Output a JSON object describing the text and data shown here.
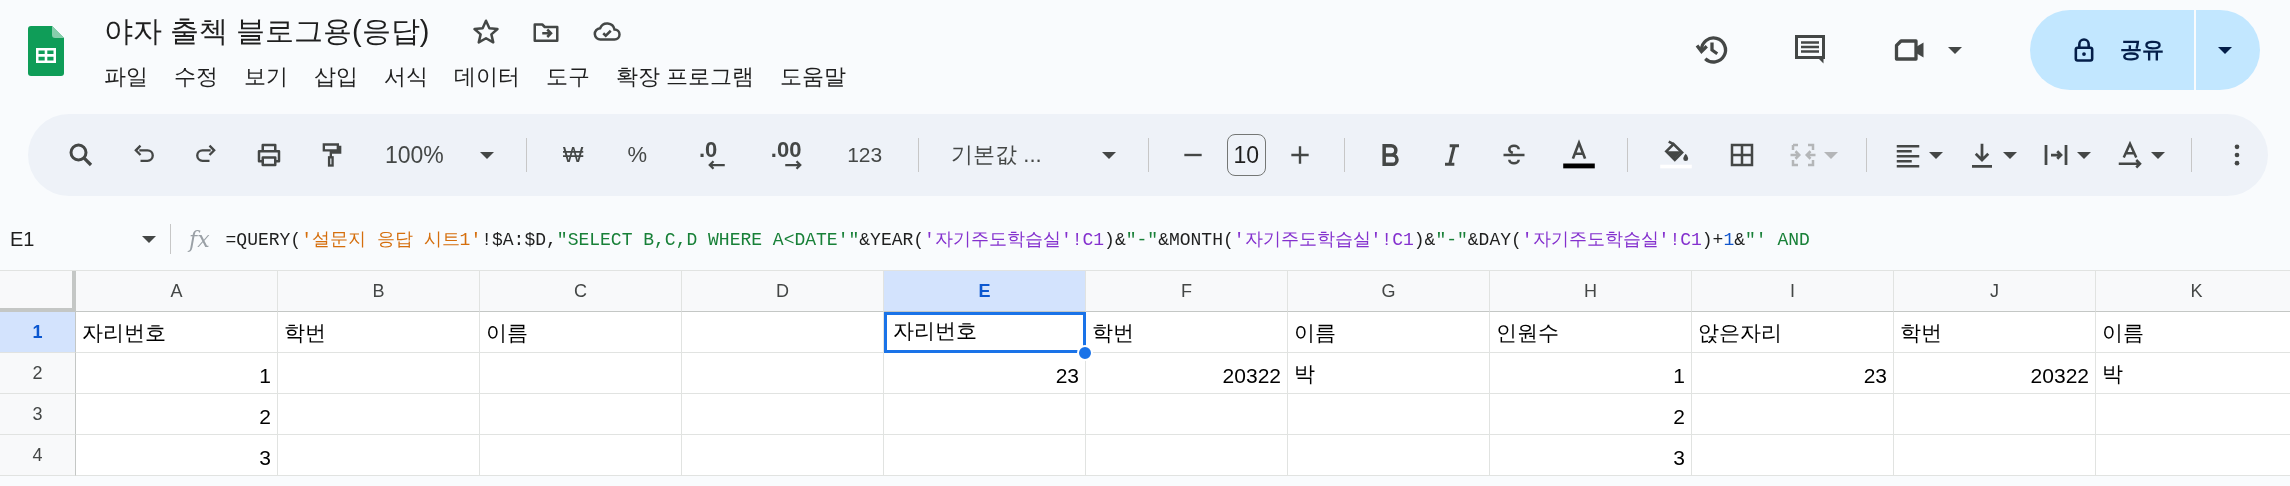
{
  "document": {
    "title": "야자 출첵 블로그용(응답)"
  },
  "menu": [
    "파일",
    "수정",
    "보기",
    "삽입",
    "서식",
    "데이터",
    "도구",
    "확장 프로그램",
    "도움말"
  ],
  "share_button": {
    "label": "공유"
  },
  "toolbar": {
    "zoom": "100%",
    "currency": "₩",
    "percent": "%",
    "decrease_decimal": ".0",
    "increase_decimal": ".00",
    "number_format": "123",
    "font": "기본값 ...",
    "font_size": "10",
    "merge_disabled": true
  },
  "formula_bar": {
    "cell": "E1",
    "fx": "fx",
    "segments": [
      {
        "text": "=QUERY(",
        "kind": "plain"
      },
      {
        "text": "'설문지 응답 시트1'",
        "kind": "range"
      },
      {
        "text": "!$A:$D,",
        "kind": "plain"
      },
      {
        "text": "\"SELECT B,C,D WHERE A<DATE'\"",
        "kind": "string"
      },
      {
        "text": "&YEAR(",
        "kind": "plain"
      },
      {
        "text": "'자기주도학습실'!C1",
        "kind": "ref"
      },
      {
        "text": ")&",
        "kind": "plain"
      },
      {
        "text": "\"-\"",
        "kind": "string"
      },
      {
        "text": "&MONTH(",
        "kind": "plain"
      },
      {
        "text": "'자기주도학습실'!C1",
        "kind": "ref"
      },
      {
        "text": ")&",
        "kind": "plain"
      },
      {
        "text": "\"-\"",
        "kind": "string"
      },
      {
        "text": "&DAY(",
        "kind": "plain"
      },
      {
        "text": "'자기주도학습실'!C1",
        "kind": "ref"
      },
      {
        "text": ")+",
        "kind": "plain"
      },
      {
        "text": "1",
        "kind": "number"
      },
      {
        "text": "&",
        "kind": "plain"
      },
      {
        "text": "\"' AND",
        "kind": "string"
      }
    ]
  },
  "sheet": {
    "columns": [
      {
        "label": "A",
        "selected": false
      },
      {
        "label": "B",
        "selected": false
      },
      {
        "label": "C",
        "selected": false
      },
      {
        "label": "D",
        "selected": false
      },
      {
        "label": "E",
        "selected": true
      },
      {
        "label": "F",
        "selected": false
      },
      {
        "label": "G",
        "selected": false
      },
      {
        "label": "H",
        "selected": false
      },
      {
        "label": "I",
        "selected": false
      },
      {
        "label": "J",
        "selected": false
      },
      {
        "label": "K",
        "selected": false
      }
    ],
    "rows": [
      {
        "label": "1",
        "selected": true,
        "cells": [
          {
            "kind": "text",
            "value": "자리번호",
            "selected": false
          },
          {
            "kind": "text",
            "value": "학번",
            "selected": false
          },
          {
            "kind": "text",
            "value": "이름",
            "selected": false
          },
          {
            "kind": "empty",
            "selected": false
          },
          {
            "kind": "text",
            "value": "자리번호",
            "selected": true
          },
          {
            "kind": "text",
            "value": "학번",
            "selected": false
          },
          {
            "kind": "text",
            "value": "이름",
            "selected": false
          },
          {
            "kind": "text",
            "value": "인원수",
            "selected": false
          },
          {
            "kind": "text",
            "value": "앉은자리",
            "selected": false
          },
          {
            "kind": "text",
            "value": "학번",
            "selected": false
          },
          {
            "kind": "text",
            "value": "이름",
            "selected": false
          }
        ]
      },
      {
        "label": "2",
        "selected": false,
        "cells": [
          {
            "kind": "number",
            "value": "1",
            "selected": false
          },
          {
            "kind": "empty",
            "selected": false
          },
          {
            "kind": "empty",
            "selected": false
          },
          {
            "kind": "empty",
            "selected": false
          },
          {
            "kind": "number",
            "value": "23",
            "selected": false
          },
          {
            "kind": "number",
            "value": "20322",
            "selected": false
          },
          {
            "kind": "text",
            "value": "박",
            "selected": false
          },
          {
            "kind": "number",
            "value": "1",
            "selected": false
          },
          {
            "kind": "number",
            "value": "23",
            "selected": false
          },
          {
            "kind": "number",
            "value": "20322",
            "selected": false
          },
          {
            "kind": "text",
            "value": "박",
            "selected": false
          }
        ]
      },
      {
        "label": "3",
        "selected": false,
        "cells": [
          {
            "kind": "number",
            "value": "2",
            "selected": false
          },
          {
            "kind": "empty",
            "selected": false
          },
          {
            "kind": "empty",
            "selected": false
          },
          {
            "kind": "empty",
            "selected": false
          },
          {
            "kind": "empty",
            "selected": false
          },
          {
            "kind": "empty",
            "selected": false
          },
          {
            "kind": "empty",
            "selected": false
          },
          {
            "kind": "number",
            "value": "2",
            "selected": false
          },
          {
            "kind": "empty",
            "selected": false
          },
          {
            "kind": "empty",
            "selected": false
          },
          {
            "kind": "empty",
            "selected": false
          }
        ]
      },
      {
        "label": "4",
        "selected": false,
        "cells": [
          {
            "kind": "number",
            "value": "3",
            "selected": false
          },
          {
            "kind": "empty",
            "selected": false
          },
          {
            "kind": "empty",
            "selected": false
          },
          {
            "kind": "empty",
            "selected": false
          },
          {
            "kind": "empty",
            "selected": false
          },
          {
            "kind": "empty",
            "selected": false
          },
          {
            "kind": "empty",
            "selected": false
          },
          {
            "kind": "number",
            "value": "3",
            "selected": false
          },
          {
            "kind": "empty",
            "selected": false
          },
          {
            "kind": "empty",
            "selected": false
          },
          {
            "kind": "empty",
            "selected": false
          }
        ]
      }
    ]
  }
}
